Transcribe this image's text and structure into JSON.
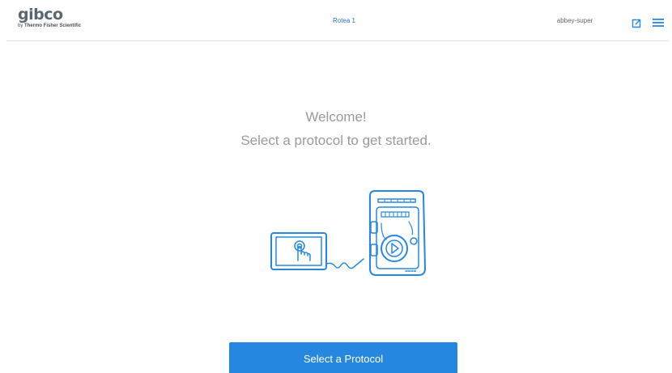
{
  "header": {
    "logo_text": "gibco",
    "logo_sub_prefix": "by",
    "logo_sub_brand": "Thermo Fisher Scientific",
    "device_name": "Rotea 1",
    "user_name": "abbey-super",
    "export_icon": "export-icon",
    "menu_icon": "hamburger-menu-icon"
  },
  "main": {
    "welcome": "Welcome!",
    "subtitle": "Select a protocol to get started.",
    "illustration": "tablet-connected-to-device-illustration",
    "button_label": "Select a Protocol"
  },
  "colors": {
    "accent": "#2687e0",
    "link": "#2e6fbf",
    "muted_text": "#9a9a9a",
    "logo_gray": "#5b6770"
  }
}
